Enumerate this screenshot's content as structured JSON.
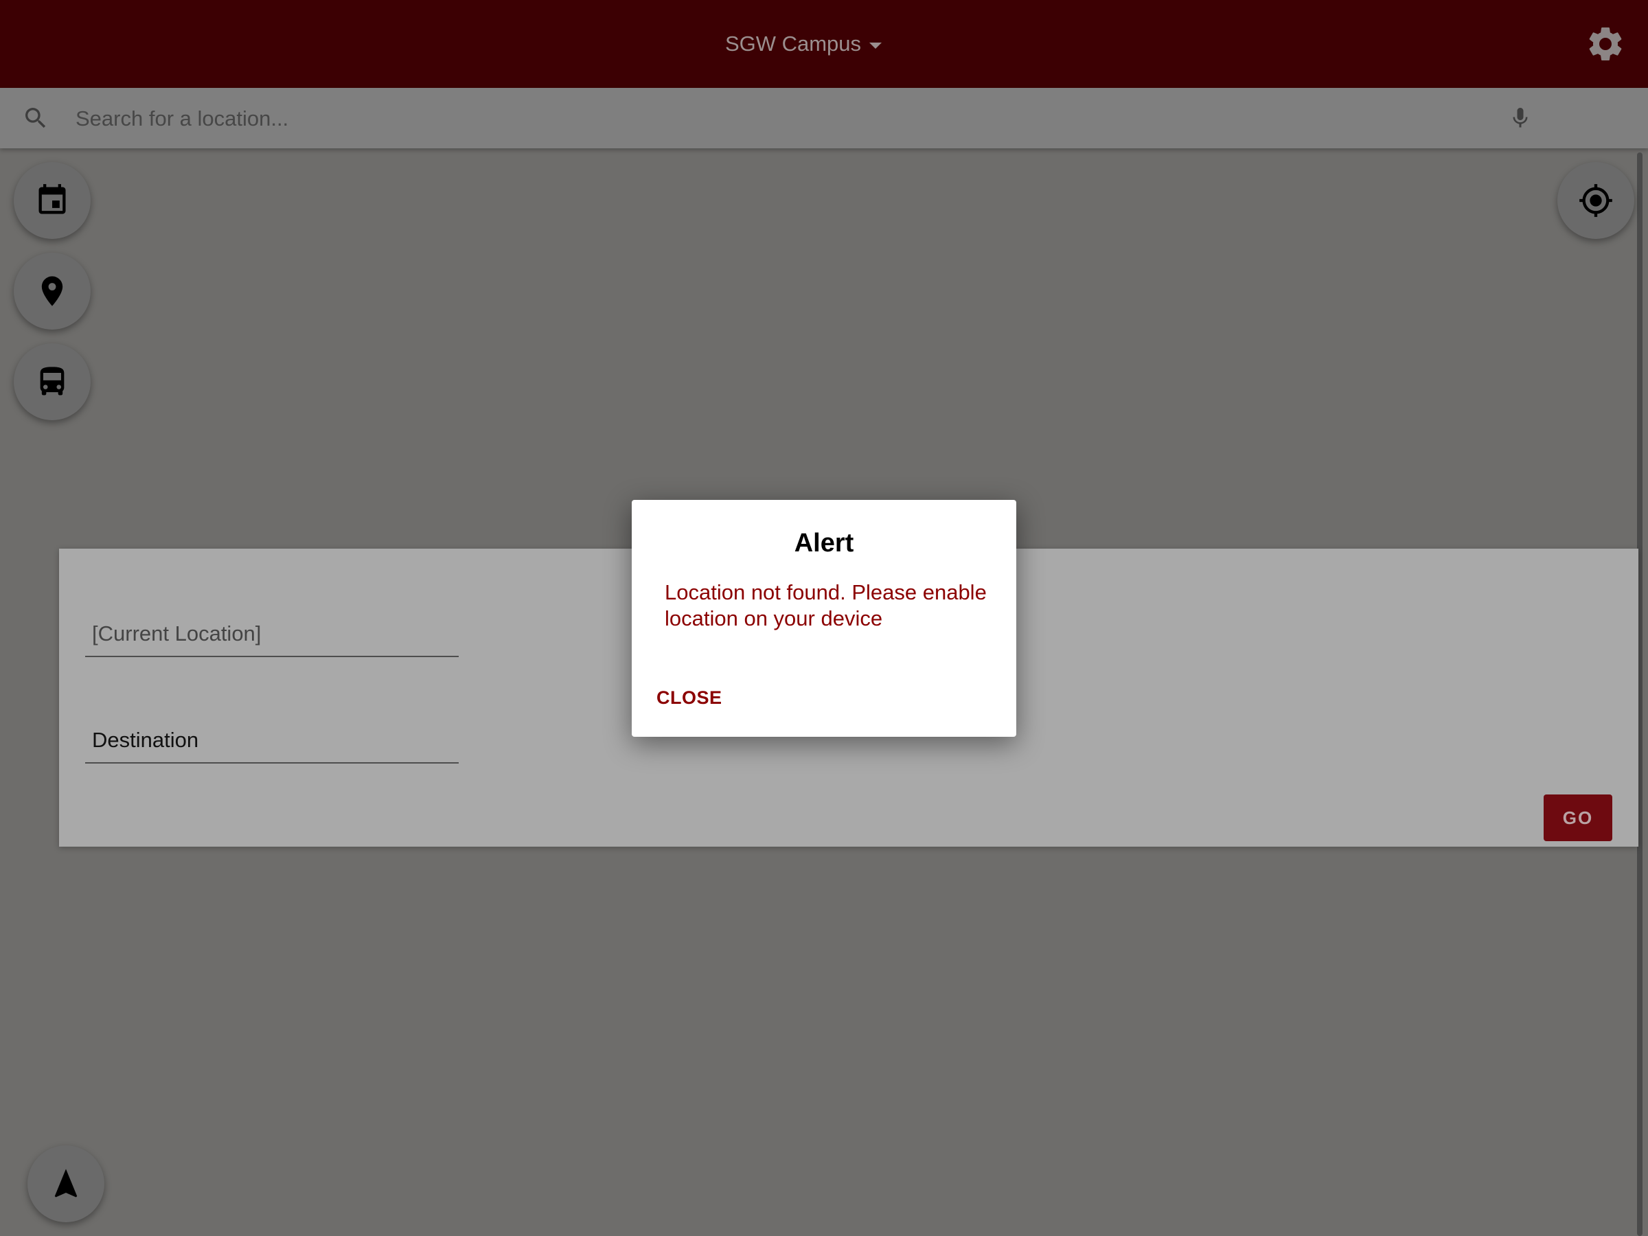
{
  "header": {
    "campus_selector": "SGW Campus",
    "settings_icon": "gear-icon"
  },
  "search": {
    "placeholder": "Search for a location...",
    "search_icon": "search-icon",
    "voice_icon": "microphone-icon"
  },
  "side_buttons": [
    {
      "name": "calendar",
      "icon": "calendar-icon"
    },
    {
      "name": "points-of-interest",
      "icon": "map-pin-icon"
    },
    {
      "name": "shuttle",
      "icon": "bus-icon"
    }
  ],
  "locate_button": {
    "icon": "crosshair-icon"
  },
  "directions_panel": {
    "origin_placeholder": "[Current Location]",
    "destination_placeholder": "Destination",
    "go_label": "GO"
  },
  "dialog": {
    "title": "Alert",
    "message": "Location not found. Please enable location on your device",
    "close_label": "CLOSE"
  },
  "navigate_button": {
    "icon": "navigation-arrow-icon"
  },
  "colors": {
    "brand": "#3c0003",
    "accent": "#8b0000",
    "overlay": "#6e6d6b"
  }
}
